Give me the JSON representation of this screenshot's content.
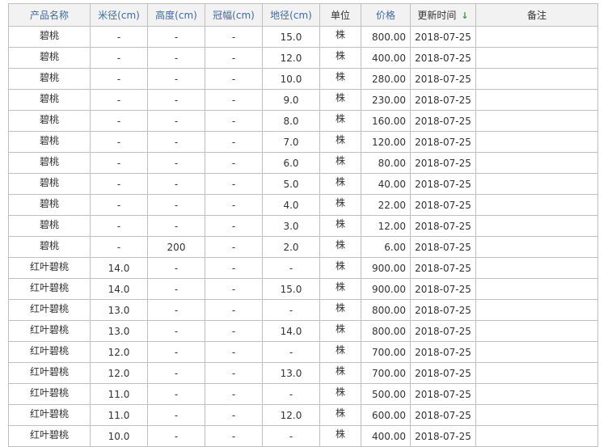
{
  "table": {
    "headers": {
      "name": "产品名称",
      "diameter": "米径(cm)",
      "height": "高度(cm)",
      "crown": "冠幅(cm)",
      "ground": "地径(cm)",
      "unit": "单位",
      "price": "价格",
      "updated": "更新时间",
      "remark": "备注"
    },
    "sort_icon": "arrow-down-icon",
    "sort_color": "#2e9e3a",
    "header_text_color": "#3e6ba3",
    "rows": [
      {
        "name": "碧桃",
        "diameter": "-",
        "height": "-",
        "crown": "-",
        "ground": "15.0",
        "unit": "株",
        "price": "800.00",
        "updated": "2018-07-25",
        "remark": ""
      },
      {
        "name": "碧桃",
        "diameter": "-",
        "height": "-",
        "crown": "-",
        "ground": "12.0",
        "unit": "株",
        "price": "400.00",
        "updated": "2018-07-25",
        "remark": ""
      },
      {
        "name": "碧桃",
        "diameter": "-",
        "height": "-",
        "crown": "-",
        "ground": "10.0",
        "unit": "株",
        "price": "280.00",
        "updated": "2018-07-25",
        "remark": ""
      },
      {
        "name": "碧桃",
        "diameter": "-",
        "height": "-",
        "crown": "-",
        "ground": "9.0",
        "unit": "株",
        "price": "230.00",
        "updated": "2018-07-25",
        "remark": ""
      },
      {
        "name": "碧桃",
        "diameter": "-",
        "height": "-",
        "crown": "-",
        "ground": "8.0",
        "unit": "株",
        "price": "160.00",
        "updated": "2018-07-25",
        "remark": ""
      },
      {
        "name": "碧桃",
        "diameter": "-",
        "height": "-",
        "crown": "-",
        "ground": "7.0",
        "unit": "株",
        "price": "120.00",
        "updated": "2018-07-25",
        "remark": ""
      },
      {
        "name": "碧桃",
        "diameter": "-",
        "height": "-",
        "crown": "-",
        "ground": "6.0",
        "unit": "株",
        "price": "80.00",
        "updated": "2018-07-25",
        "remark": ""
      },
      {
        "name": "碧桃",
        "diameter": "-",
        "height": "-",
        "crown": "-",
        "ground": "5.0",
        "unit": "株",
        "price": "40.00",
        "updated": "2018-07-25",
        "remark": ""
      },
      {
        "name": "碧桃",
        "diameter": "-",
        "height": "-",
        "crown": "-",
        "ground": "4.0",
        "unit": "株",
        "price": "22.00",
        "updated": "2018-07-25",
        "remark": ""
      },
      {
        "name": "碧桃",
        "diameter": "-",
        "height": "-",
        "crown": "-",
        "ground": "3.0",
        "unit": "株",
        "price": "12.00",
        "updated": "2018-07-25",
        "remark": ""
      },
      {
        "name": "碧桃",
        "diameter": "-",
        "height": "200",
        "crown": "-",
        "ground": "2.0",
        "unit": "株",
        "price": "6.00",
        "updated": "2018-07-25",
        "remark": ""
      },
      {
        "name": "红叶碧桃",
        "diameter": "14.0",
        "height": "-",
        "crown": "-",
        "ground": "-",
        "unit": "株",
        "price": "900.00",
        "updated": "2018-07-25",
        "remark": ""
      },
      {
        "name": "红叶碧桃",
        "diameter": "14.0",
        "height": "-",
        "crown": "-",
        "ground": "15.0",
        "unit": "株",
        "price": "900.00",
        "updated": "2018-07-25",
        "remark": ""
      },
      {
        "name": "红叶碧桃",
        "diameter": "13.0",
        "height": "-",
        "crown": "-",
        "ground": "-",
        "unit": "株",
        "price": "800.00",
        "updated": "2018-07-25",
        "remark": ""
      },
      {
        "name": "红叶碧桃",
        "diameter": "13.0",
        "height": "-",
        "crown": "-",
        "ground": "14.0",
        "unit": "株",
        "price": "800.00",
        "updated": "2018-07-25",
        "remark": ""
      },
      {
        "name": "红叶碧桃",
        "diameter": "12.0",
        "height": "-",
        "crown": "-",
        "ground": "-",
        "unit": "株",
        "price": "700.00",
        "updated": "2018-07-25",
        "remark": ""
      },
      {
        "name": "红叶碧桃",
        "diameter": "12.0",
        "height": "-",
        "crown": "-",
        "ground": "13.0",
        "unit": "株",
        "price": "700.00",
        "updated": "2018-07-25",
        "remark": ""
      },
      {
        "name": "红叶碧桃",
        "diameter": "11.0",
        "height": "-",
        "crown": "-",
        "ground": "-",
        "unit": "株",
        "price": "500.00",
        "updated": "2018-07-25",
        "remark": ""
      },
      {
        "name": "红叶碧桃",
        "diameter": "11.0",
        "height": "-",
        "crown": "-",
        "ground": "12.0",
        "unit": "株",
        "price": "600.00",
        "updated": "2018-07-25",
        "remark": ""
      },
      {
        "name": "红叶碧桃",
        "diameter": "10.0",
        "height": "-",
        "crown": "-",
        "ground": "-",
        "unit": "株",
        "price": "400.00",
        "updated": "2018-07-25",
        "remark": ""
      }
    ]
  }
}
